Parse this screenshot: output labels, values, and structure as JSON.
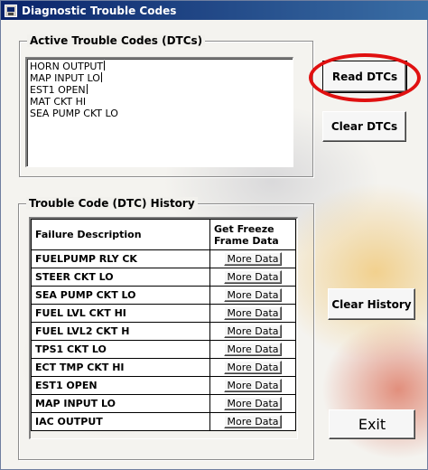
{
  "window": {
    "title": "Diagnostic Trouble Codes"
  },
  "active": {
    "title": "Active Trouble Codes (DTCs)",
    "codes": [
      "HORN OUTPUT",
      "MAP INPUT LO",
      "EST1 OPEN",
      "MAT CKT HI",
      "SEA PUMP CKT LO"
    ]
  },
  "buttons": {
    "read": "Read DTCs",
    "clear": "Clear DTCs",
    "clear_history": "Clear History",
    "exit": "Exit"
  },
  "history": {
    "title": "Trouble Code (DTC) History",
    "col_failure": "Failure Description",
    "col_freeze": "Get Freeze Frame Data",
    "more_label": "More Data",
    "rows": [
      "FUELPUMP RLY CK",
      "STEER CKT LO",
      "SEA PUMP CKT LO",
      "FUEL LVL CKT HI",
      "FUEL LVL2 CKT H",
      "TPS1 CKT LO",
      "ECT TMP CKT HI",
      "EST1 OPEN",
      "MAP INPUT LO",
      "IAC OUTPUT"
    ]
  },
  "colors": {
    "highlight_ring": "#e01010",
    "titlebar": "#0a246a"
  }
}
